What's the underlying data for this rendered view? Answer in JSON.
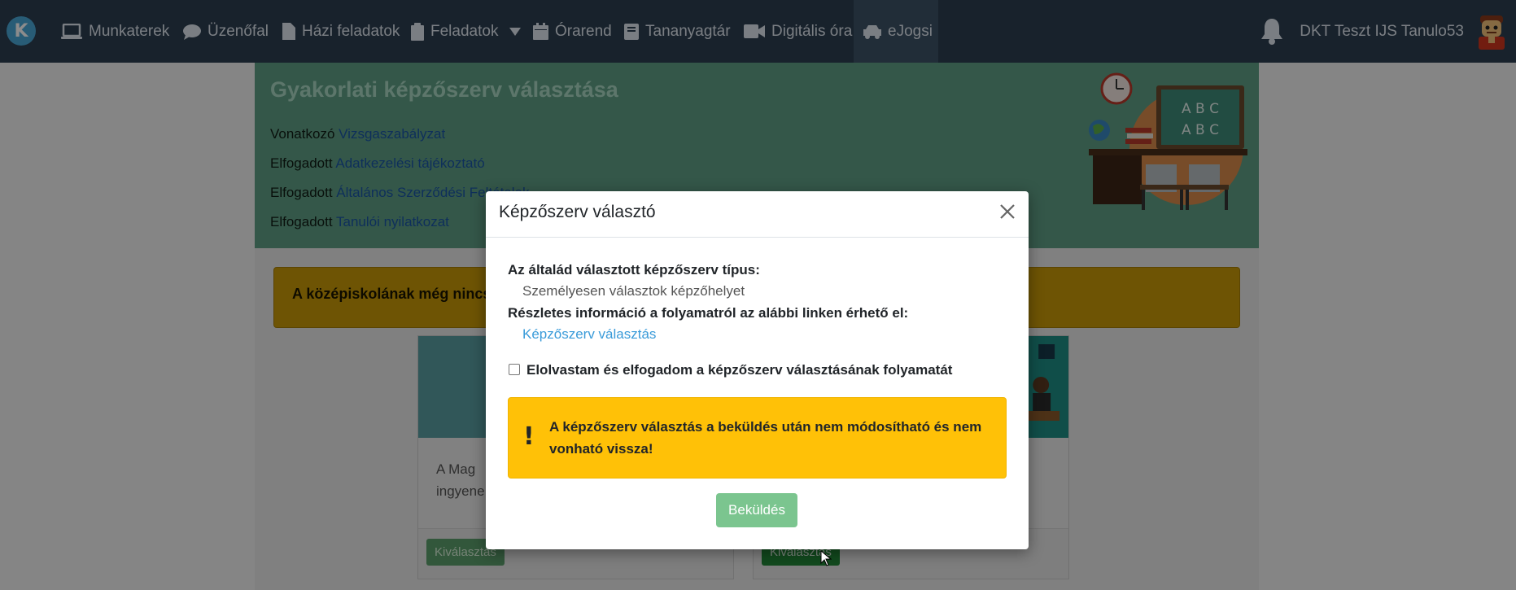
{
  "navbar": {
    "logo_letter": "K",
    "items": [
      {
        "label": "Munkaterek",
        "icon": "laptop-icon"
      },
      {
        "label": "Üzenőfal",
        "icon": "comment-icon"
      },
      {
        "label": "Házi feladatok",
        "icon": "file-icon"
      },
      {
        "label": "Feladatok",
        "icon": "clipboard-icon",
        "dropdown": true
      },
      {
        "label": "Órarend",
        "icon": "calendar-icon"
      },
      {
        "label": "Tananyagtár",
        "icon": "book-icon"
      },
      {
        "label": "Digitális óra",
        "icon": "video-icon"
      },
      {
        "label": "eJogsi",
        "icon": "car-icon",
        "active": true
      }
    ],
    "user_name": "DKT Teszt IJS Tanulo53",
    "bell_icon": "bell-icon"
  },
  "header_panel": {
    "title": "Gyakorlati képzőszerv választása",
    "lines": [
      {
        "prefix": "Vonatkozó",
        "link": "Vizsgaszabályzat"
      },
      {
        "prefix": "Elfogadott",
        "link": "Adatkezelési tájékoztató"
      },
      {
        "prefix": "Elfogadott",
        "link": "Általános Szerződési Feltételek"
      },
      {
        "prefix": "Elfogadott",
        "link": "Tanulói nyilatkozat"
      }
    ]
  },
  "warning_bar": {
    "text": "A középiskolának még nincs e"
  },
  "cards": [
    {
      "text_line1": "A   Mag",
      "text_line2": "ingyene",
      "button": "Kiválasztás"
    },
    {
      "button": "Kiválasztás"
    }
  ],
  "modal": {
    "title": "Képzőszerv választó",
    "type_label": "Az általád választott képzőszerv típus:",
    "type_value": "Személyesen választok képzőhelyet",
    "info_label": "Részletes információ a folyamatról az alábbi linken érhető el:",
    "info_link": "Képzőszerv választás",
    "checkbox_label": "Elolvastam és elfogadom a képzőszerv választásának folyamatát",
    "checkbox_checked": false,
    "alert_text": "A képzőszerv választás a beküldés után nem módosítható és nem vonható vissza!",
    "submit_label": "Beküldés"
  },
  "colors": {
    "navbar": "#2c3e50",
    "header_panel": "#5f9f85",
    "alert": "#ffc107",
    "submit": "#7bc58f",
    "link": "#3a9bd9"
  }
}
